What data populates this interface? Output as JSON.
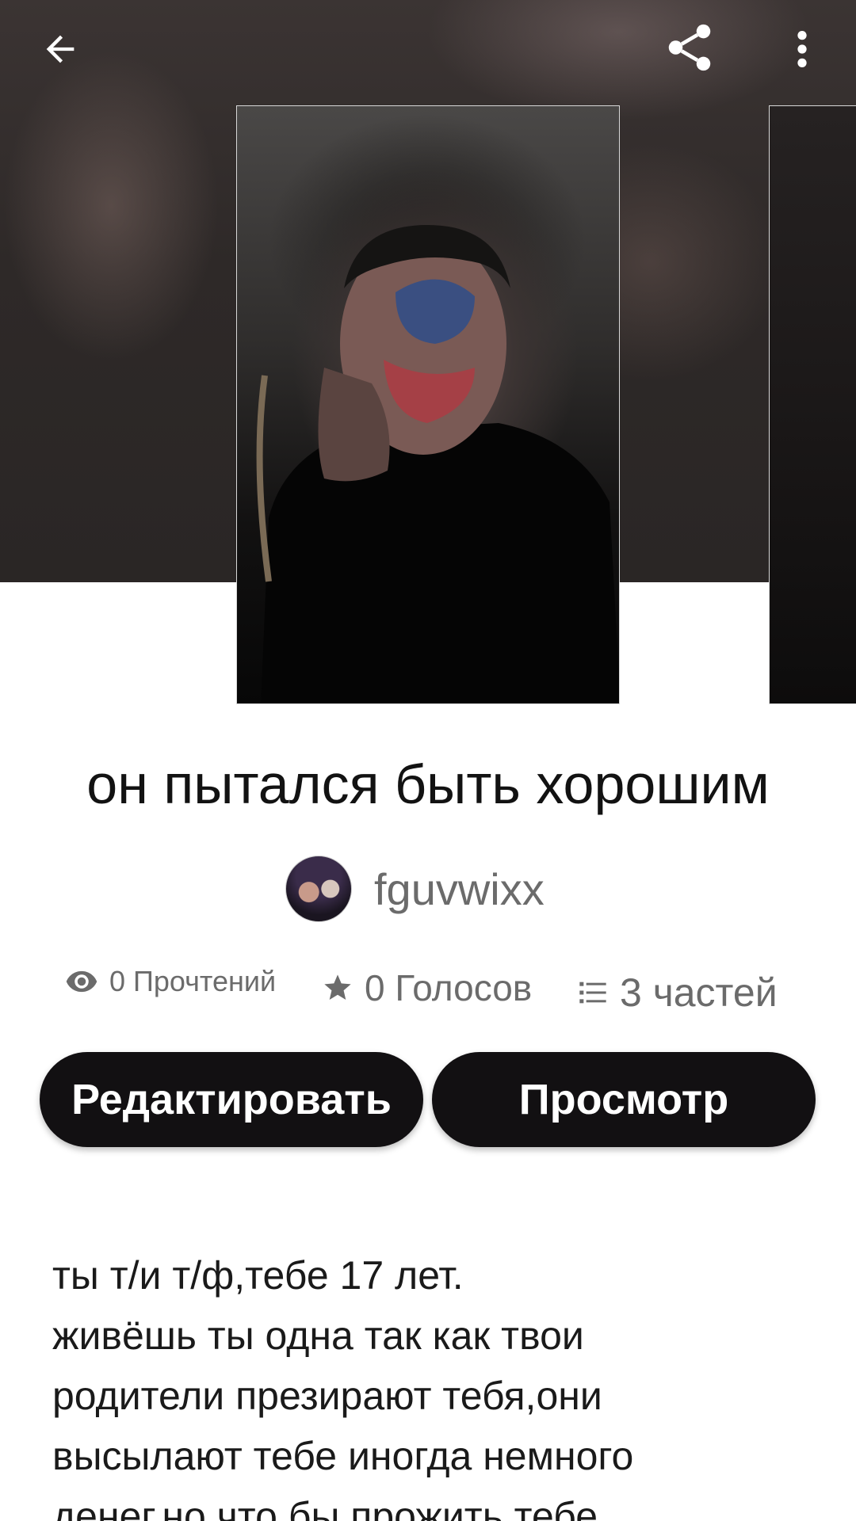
{
  "hero": {
    "back_icon": "arrow-left-icon",
    "share_icon": "share-icon",
    "more_icon": "more-vertical-icon"
  },
  "story": {
    "title": "он пытался быть хорошим",
    "author": "fguvwixx"
  },
  "stats": {
    "reads": "0 Прочтений",
    "votes": "0 Голосов",
    "parts": "3 частей",
    "reads_icon": "eye-icon",
    "votes_icon": "star-icon",
    "parts_icon": "list-icon"
  },
  "buttons": {
    "edit": "Редактировать",
    "view": "Просмотр"
  },
  "description": {
    "lines": [
      "ты т/и т/ф,тебе 17 лет.",
      "живёшь ты одна так как твои",
      "родители презирают тебя,они",
      "высылают тебе иногда немного",
      "денег,но что бы прожить тебе"
    ]
  },
  "colors": {
    "button_bg": "#121012",
    "title_text": "#121212",
    "muted_text": "#6b6b6b"
  }
}
